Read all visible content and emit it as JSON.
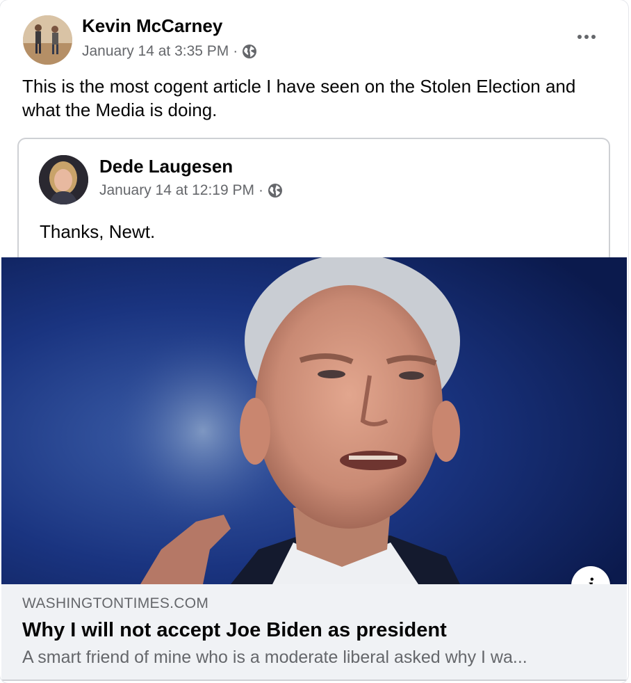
{
  "post": {
    "author": "Kevin McCarney",
    "timestamp": "January 14 at 3:35 PM",
    "separator": "·",
    "audience_icon": "globe-icon",
    "more_icon": "more-options-icon",
    "text": "This is the most cogent article I have seen on the Stolen Election and what the Media is doing."
  },
  "shared_post": {
    "author": "Dede Laugesen",
    "timestamp": "January 14 at 12:19 PM",
    "separator": "·",
    "audience_icon": "globe-icon",
    "text": "Thanks, Newt."
  },
  "link_preview": {
    "image": "article-photo",
    "info_icon": "i",
    "domain": "WASHINGTONTIMES.COM",
    "title": "Why I will not accept Joe Biden as president",
    "description": "A smart friend of mine who is a moderate liberal asked why I wa..."
  },
  "colors": {
    "text_primary": "#050505",
    "text_secondary": "#65676b",
    "link_footer_bg": "#f0f2f5",
    "border": "#ced0d4"
  }
}
